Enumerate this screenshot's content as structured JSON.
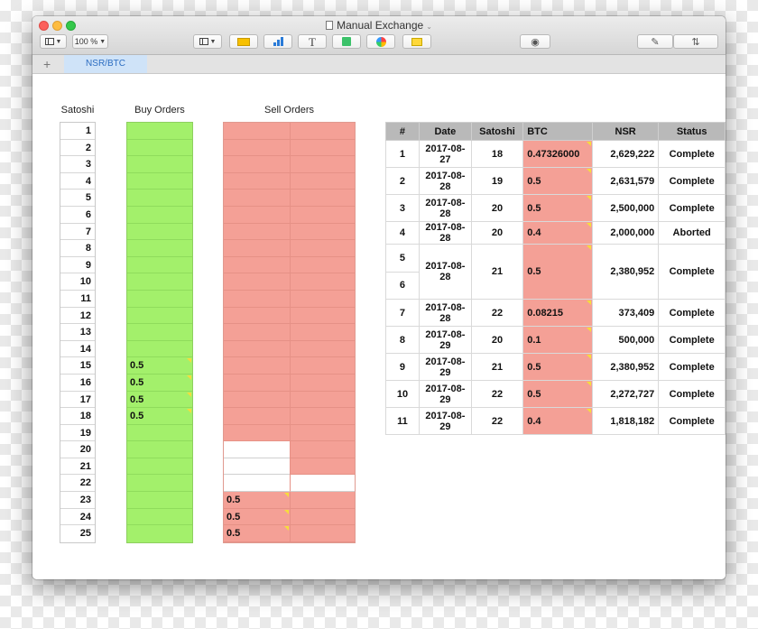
{
  "window": {
    "title": "Manual Exchange",
    "zoom": "100 %"
  },
  "toolbar": {
    "buttons": [
      "view",
      "zoom",
      "insert",
      "table",
      "chart",
      "text",
      "shape",
      "media",
      "comment",
      "collaborate",
      "format",
      "organize"
    ]
  },
  "tabs": {
    "add": "+",
    "sheet": "NSR/BTC"
  },
  "headers": {
    "satoshi": "Satoshi",
    "buy": "Buy Orders",
    "sell": "Sell Orders"
  },
  "satoshi": [
    "1",
    "2",
    "3",
    "4",
    "5",
    "6",
    "7",
    "8",
    "9",
    "10",
    "11",
    "12",
    "13",
    "14",
    "15",
    "16",
    "17",
    "18",
    "19",
    "20",
    "21",
    "22",
    "23",
    "24",
    "25"
  ],
  "buy_orders": [
    "",
    "",
    "",
    "",
    "",
    "",
    "",
    "",
    "",
    "",
    "",
    "",
    "",
    "",
    "0.5",
    "0.5",
    "0.5",
    "0.5",
    "",
    "",
    "",
    "",
    "",
    "",
    ""
  ],
  "sell_orders": [
    "",
    "",
    "",
    "",
    "",
    "",
    "",
    "",
    "",
    "",
    "",
    "",
    "",
    "",
    "",
    "",
    "",
    "",
    "",
    "",
    "",
    "",
    "0.5",
    "0.5",
    "0.5"
  ],
  "trades": {
    "columns": [
      "#",
      "Date",
      "Satoshi",
      "BTC",
      "NSR",
      "Status"
    ],
    "rows": [
      {
        "num": "1",
        "date": "2017-08-27",
        "satoshi": "18",
        "btc": "0.47326000",
        "nsr": "2,629,222",
        "status": "Complete"
      },
      {
        "num": "2",
        "date": "2017-08-28",
        "satoshi": "19",
        "btc": "0.5",
        "nsr": "2,631,579",
        "status": "Complete"
      },
      {
        "num": "3",
        "date": "2017-08-28",
        "satoshi": "20",
        "btc": "0.5",
        "nsr": "2,500,000",
        "status": "Complete"
      },
      {
        "num": "4",
        "date": "2017-08-28",
        "satoshi": "20",
        "btc": "0.4",
        "nsr": "2,000,000",
        "status": "Aborted"
      },
      {
        "num": "5",
        "num2": "6",
        "date": "2017-08-28",
        "satoshi": "21",
        "btc": "0.5",
        "nsr": "2,380,952",
        "status": "Complete"
      },
      {
        "num": "7",
        "date": "2017-08-28",
        "satoshi": "22",
        "btc": "0.08215",
        "nsr": "373,409",
        "status": "Complete"
      },
      {
        "num": "8",
        "date": "2017-08-29",
        "satoshi": "20",
        "btc": "0.1",
        "nsr": "500,000",
        "status": "Complete"
      },
      {
        "num": "9",
        "date": "2017-08-29",
        "satoshi": "21",
        "btc": "0.5",
        "nsr": "2,380,952",
        "status": "Complete"
      },
      {
        "num": "10",
        "date": "2017-08-29",
        "satoshi": "22",
        "btc": "0.5",
        "nsr": "2,272,727",
        "status": "Complete"
      },
      {
        "num": "11",
        "date": "2017-08-29",
        "satoshi": "22",
        "btc": "0.4",
        "nsr": "1,818,182",
        "status": "Complete"
      }
    ]
  },
  "colors": {
    "buy": "#a3f06b",
    "sell": "#f4a096",
    "header": "#b9b9b9",
    "accent": "#2c6dc1"
  }
}
